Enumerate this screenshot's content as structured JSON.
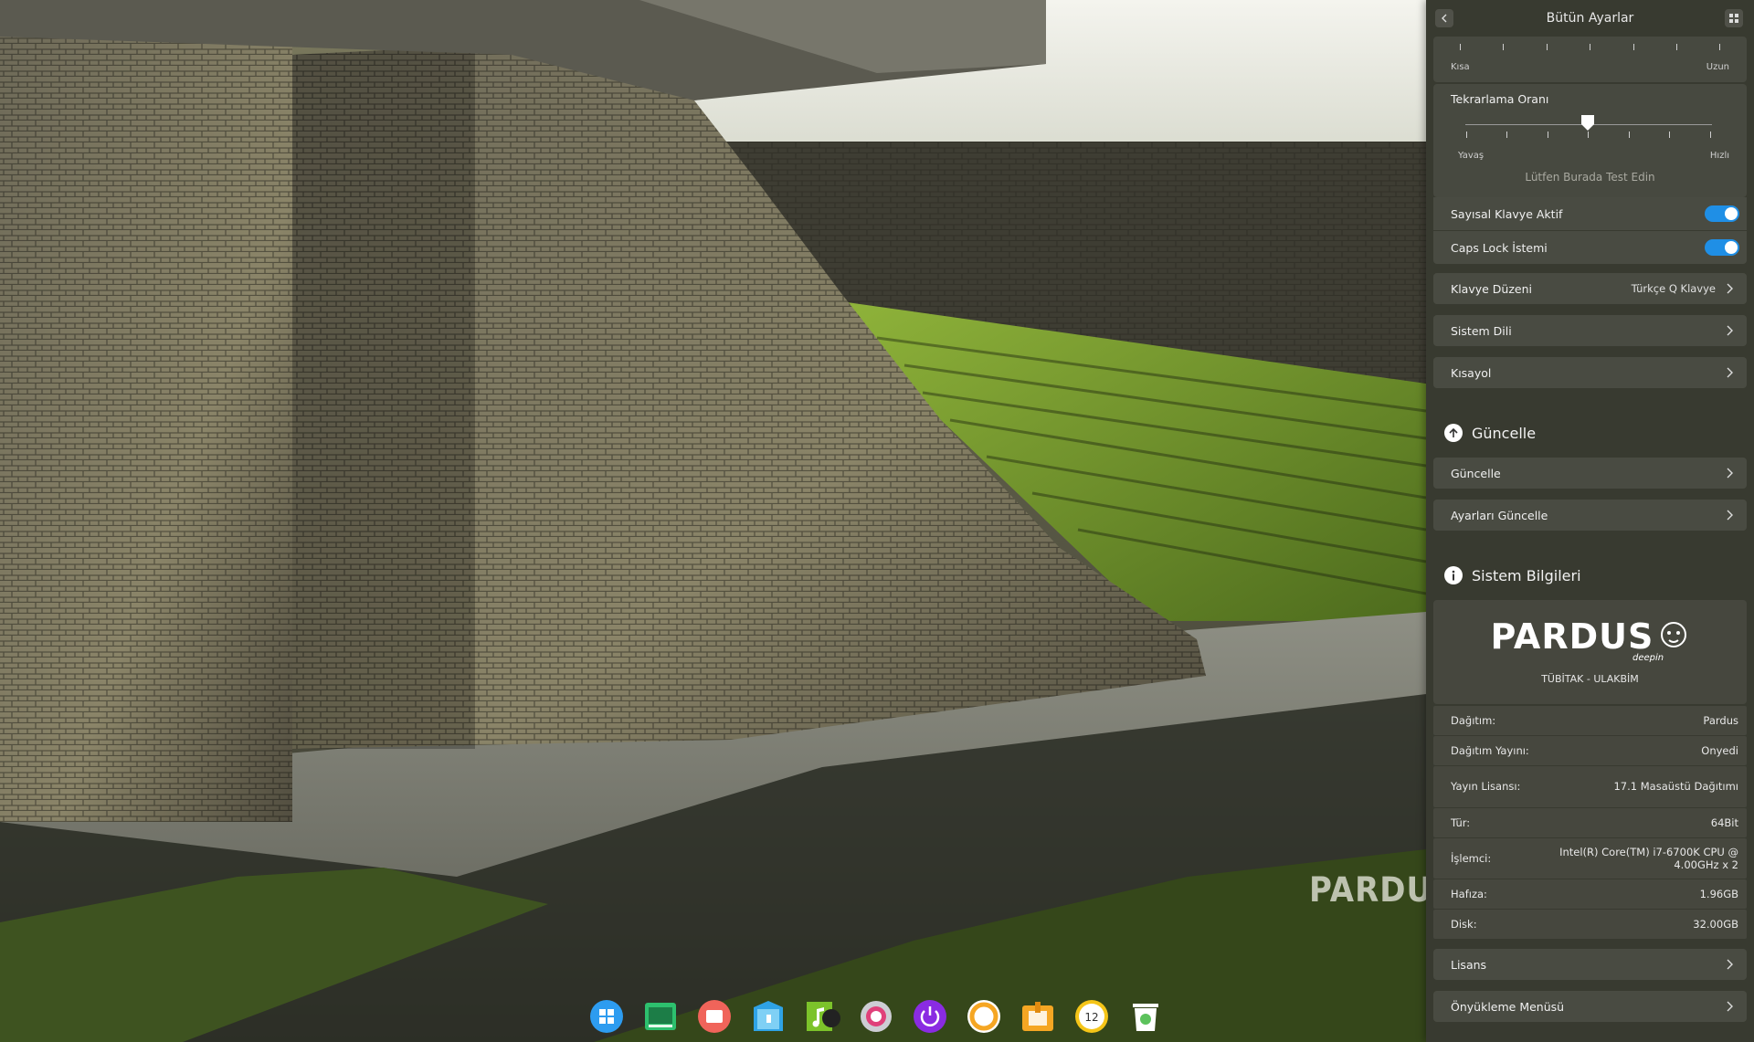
{
  "panel": {
    "title": "Bütün Ayarlar",
    "repeat_delay": {
      "left": "Kısa",
      "right": "Uzun"
    },
    "repeat_rate": {
      "label": "Tekrarlama Oranı",
      "left": "Yavaş",
      "right": "Hızlı",
      "level": 0.5
    },
    "test_placeholder": "Lütfen Burada Test Edin",
    "numlock": {
      "label": "Sayısal Klavye Aktif",
      "on": true
    },
    "capslock": {
      "label": "Caps Lock İstemi",
      "on": true
    },
    "keyboard_layout": {
      "label": "Klavye Düzeni",
      "value": "Türkçe Q Klavye"
    },
    "system_language": "Sistem Dili",
    "shortcuts": "Kısayol",
    "update_section": {
      "title": "Güncelle",
      "items": [
        "Güncelle",
        "Ayarları Güncelle"
      ]
    },
    "sysinfo_section": {
      "title": "Sistem Bilgileri",
      "logo_text": "PARDUS",
      "logo_sub": "deepin",
      "org": "TÜBİTAK - ULAKBİM",
      "rows": [
        {
          "k": "Dağıtım:",
          "v": "Pardus"
        },
        {
          "k": "Dağıtım Yayını:",
          "v": "Onyedi"
        },
        {
          "k": "Yayın Lisansı:",
          "v": "17.1 Masaüstü Dağıtımı"
        },
        {
          "k": "Tür:",
          "v": "64Bit"
        },
        {
          "k": "İşlemci:",
          "v": "Intel(R) Core(TM) i7-6700K CPU @ 4.00GHz x 2"
        },
        {
          "k": "Hafıza:",
          "v": "1.96GB"
        },
        {
          "k": "Disk:",
          "v": "32.00GB"
        }
      ]
    },
    "license": "Lisans",
    "boot_menu": "Önyükleme Menüsü"
  },
  "wallpaper": {
    "watermark": "PARDUS"
  },
  "dock": {
    "icons": [
      "launcher-icon",
      "terminal-icon",
      "screenshot-icon",
      "file-manager-icon",
      "music-icon",
      "settings-icon",
      "shutdown-icon",
      "browser-icon",
      "app-store-icon",
      "clock-icon",
      "trash-icon"
    ],
    "colors": {
      "accent": "#1f8fe6"
    }
  }
}
